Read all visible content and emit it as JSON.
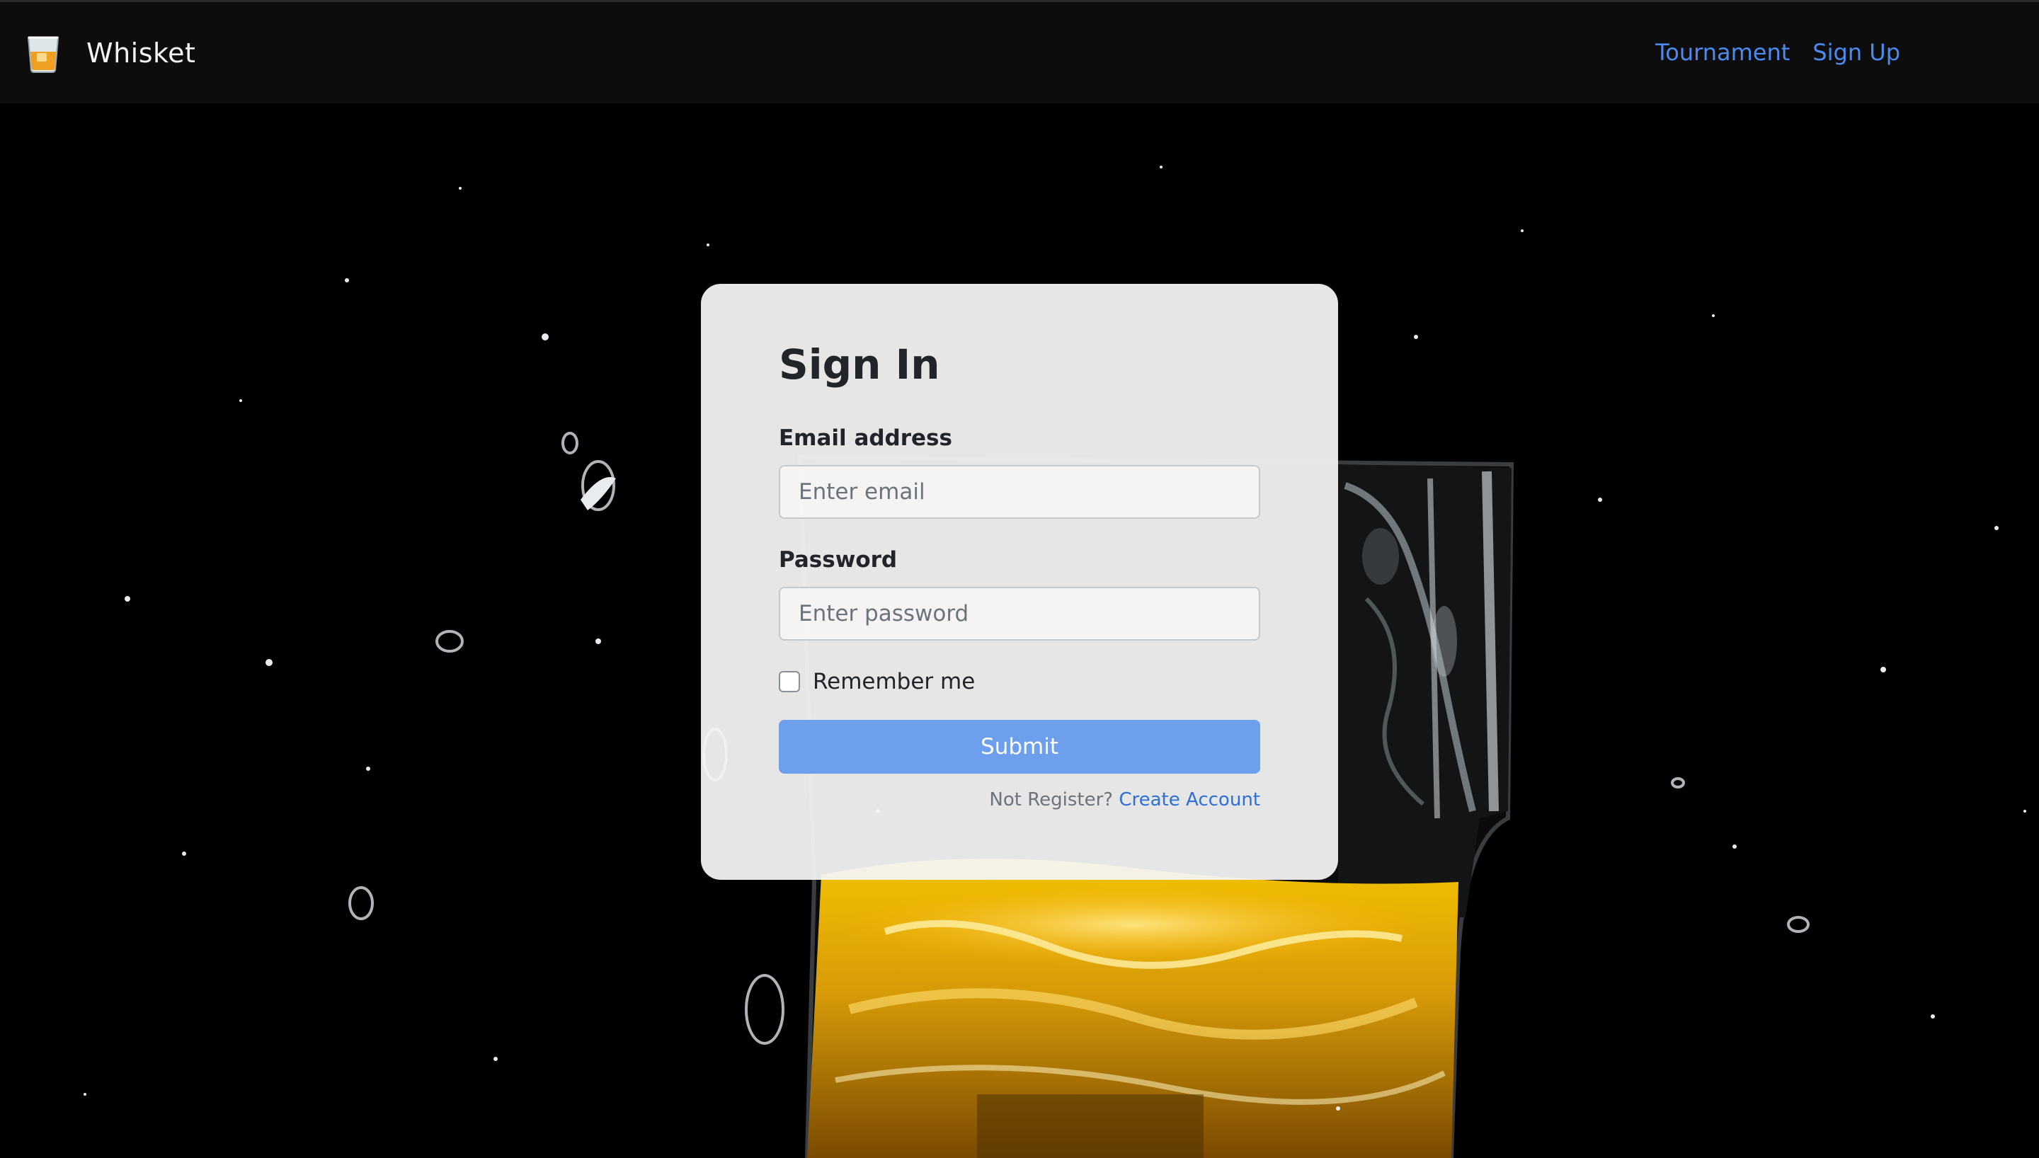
{
  "navbar": {
    "brand_name": "Whisket",
    "brand_icon": "whisky-glass-icon",
    "links": [
      {
        "label": "Tournament"
      },
      {
        "label": "Sign Up"
      }
    ]
  },
  "signin": {
    "title": "Sign In",
    "email_label": "Email address",
    "email_placeholder": "Enter email",
    "email_value": "",
    "password_label": "Password",
    "password_placeholder": "Enter password",
    "password_value": "",
    "remember_label": "Remember me",
    "remember_checked": false,
    "submit_label": "Submit",
    "register_prompt": "Not Register?",
    "register_link": "Create Account"
  },
  "colors": {
    "navbar_bg": "#0d0d0d",
    "nav_link": "#4c8af0",
    "submit_bg": "#6d9fec",
    "card_bg": "#f4f4f4",
    "register_link": "#2f6fd6"
  }
}
